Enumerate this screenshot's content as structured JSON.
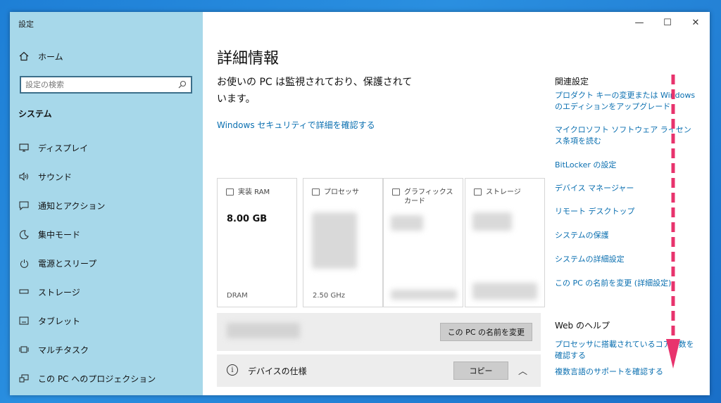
{
  "window": {
    "app_title": "設定",
    "controls": {
      "minimize": "—",
      "maximize": "☐",
      "close": "✕"
    }
  },
  "sidebar": {
    "home": "ホーム",
    "search_placeholder": "設定の検索",
    "section_title": "システム",
    "items": [
      {
        "label": "ディスプレイ",
        "icon": "display-icon"
      },
      {
        "label": "サウンド",
        "icon": "speaker-icon"
      },
      {
        "label": "通知とアクション",
        "icon": "notification-icon"
      },
      {
        "label": "集中モード",
        "icon": "moon-icon"
      },
      {
        "label": "電源とスリープ",
        "icon": "power-icon"
      },
      {
        "label": "ストレージ",
        "icon": "storage-icon"
      },
      {
        "label": "タブレット",
        "icon": "tablet-icon"
      },
      {
        "label": "マルチタスク",
        "icon": "multitask-icon"
      },
      {
        "label": "この PC へのプロジェクション",
        "icon": "projection-icon"
      }
    ]
  },
  "main": {
    "title": "詳細情報",
    "status": "お使いの PC は監視されており、保護されています。",
    "security_link": "Windows セキュリティで詳細を確認する",
    "cards": [
      {
        "label": "実装 RAM",
        "value": "8.00 GB",
        "foot": "DRAM",
        "icon": "ram-icon"
      },
      {
        "label": "プロセッサ",
        "value": "",
        "foot": "2.50 GHz",
        "icon": "processor-icon"
      },
      {
        "label": "グラフィックス カード",
        "value": "",
        "foot": "",
        "icon": "gpu-icon"
      },
      {
        "label": "ストレージ",
        "value": "",
        "foot": "",
        "icon": "storage-icon"
      }
    ],
    "rename_button": "この PC の名前を変更",
    "device_spec_label": "デバイスの仕様",
    "copy_button": "コピー"
  },
  "related": {
    "title": "関連設定",
    "links": [
      "プロダクト キーの変更または Windows のエディションをアップグレード",
      "マイクロソフト ソフトウェア ライセンス条項を読む",
      "BitLocker の設定",
      "デバイス マネージャー",
      "リモート デスクトップ",
      "システムの保護",
      "システムの詳細設定",
      "この PC の名前を変更 (詳細設定)"
    ],
    "web_help_title": "Web のヘルプ",
    "web_links": [
      "プロセッサに搭載されているコアの数を確認する",
      "複数言語のサポートを確認する"
    ]
  },
  "colors": {
    "sidebar": "#a7d8ea",
    "link": "#0a6fb0",
    "annotation_arrow": "#e8336d"
  }
}
